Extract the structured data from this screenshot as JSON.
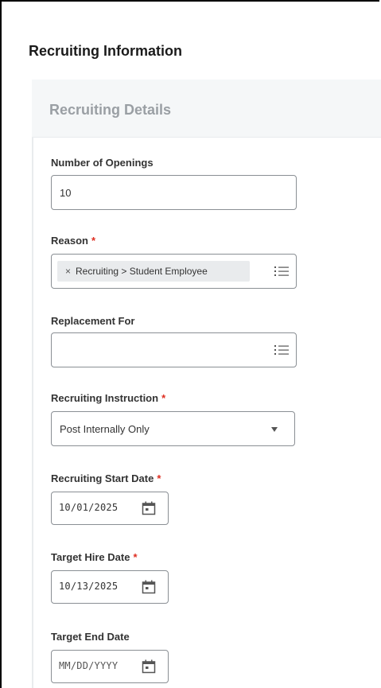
{
  "section_title": "Recruiting Information",
  "card_title": "Recruiting Details",
  "fields": {
    "openings": {
      "label": "Number of Openings",
      "value": "10"
    },
    "reason": {
      "label": "Reason",
      "required_mark": "*",
      "pill_remove": "×",
      "pill_text": "Recruiting > Student Employee",
      "icon": "list-icon"
    },
    "replacement": {
      "label": "Replacement For",
      "value": "",
      "icon": "list-icon"
    },
    "instruction": {
      "label": "Recruiting Instruction",
      "required_mark": "*",
      "value": "Post Internally Only",
      "icon": "dropdown-arrow-icon"
    },
    "start_date": {
      "label": "Recruiting Start Date",
      "required_mark": "*",
      "value": "10/01/2025",
      "icon": "calendar-icon"
    },
    "target_hire": {
      "label": "Target Hire Date",
      "required_mark": "*",
      "value": "10/13/2025",
      "icon": "calendar-icon"
    },
    "target_end": {
      "label": "Target End Date",
      "placeholder": "MM/DD/YYYY",
      "icon": "calendar-icon"
    }
  },
  "colors": {
    "required": "#de2e21",
    "border": "#8a8f94",
    "header_bg": "#f5f7f8",
    "pill_bg": "#e9ebed"
  }
}
